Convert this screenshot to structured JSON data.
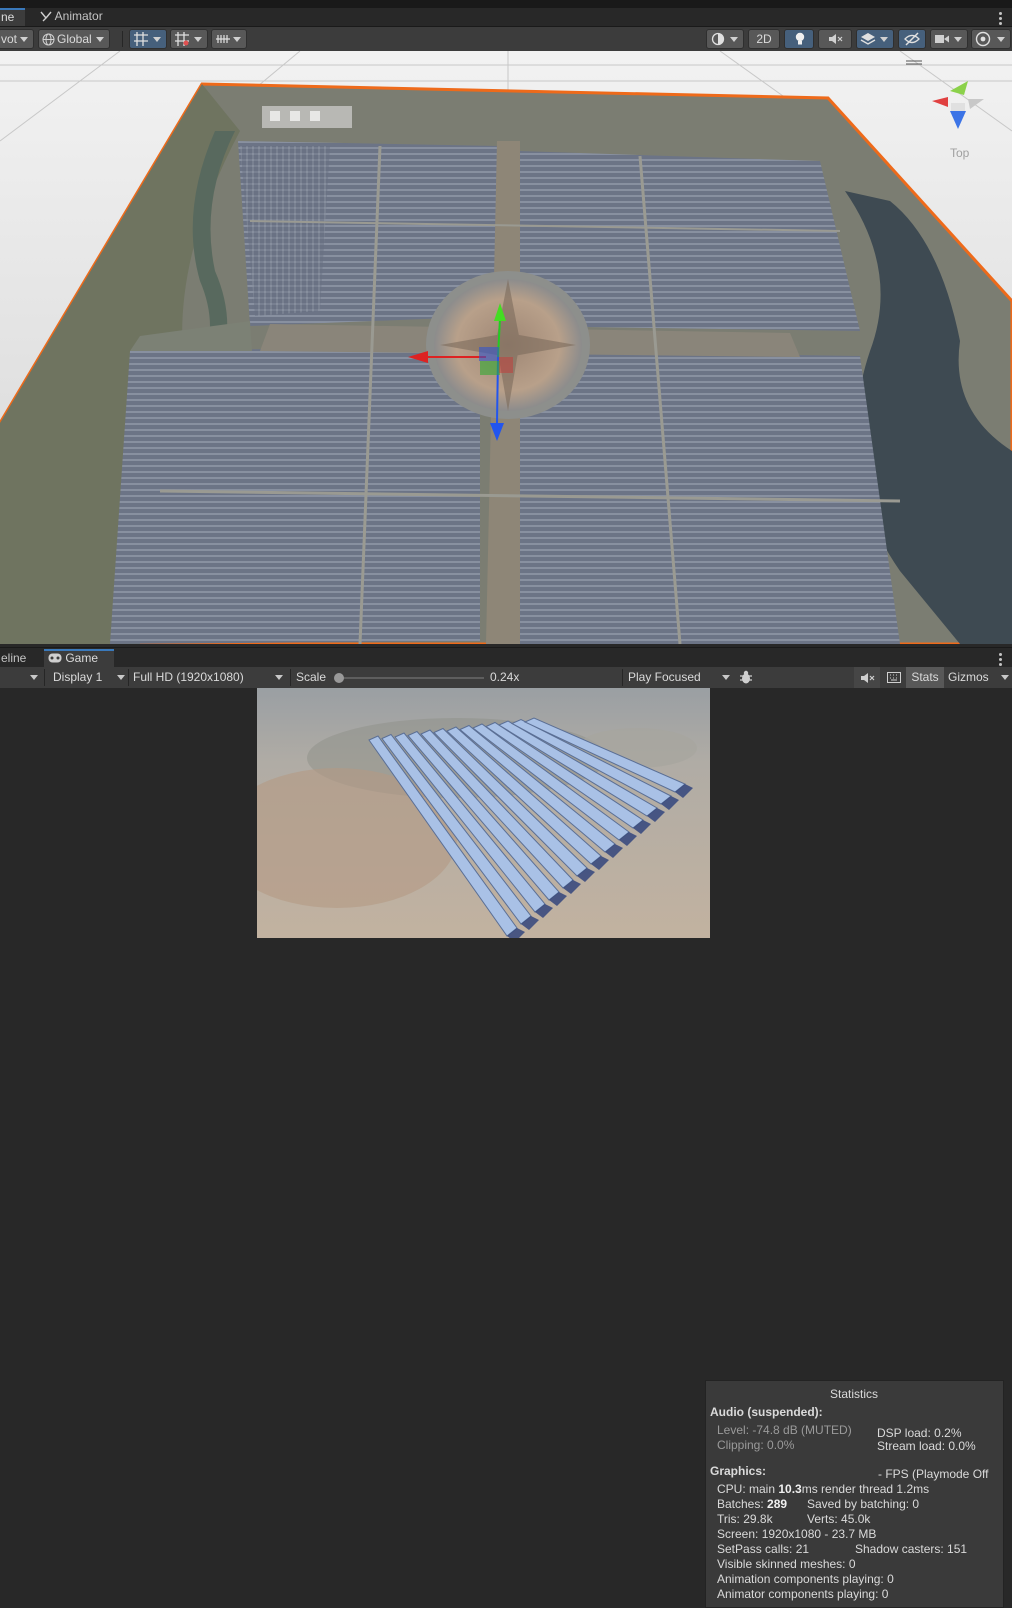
{
  "tabs": {
    "scene_label": "ne",
    "animator_label": "Animator"
  },
  "toolbar": {
    "pivot_label": "vot",
    "global_label": "Global",
    "mode_2d_label": "2D"
  },
  "scene": {
    "orientation_label": "Top"
  },
  "game_tabs": {
    "timeline_label": "eline",
    "game_label": "Game"
  },
  "game_toolbar": {
    "display_label": "Display 1",
    "resolution_label": "Full HD (1920x1080)",
    "scale_label": "Scale",
    "scale_value": "0.24x",
    "scale_slider_fraction": 0.0,
    "play_mode_label": "Play Focused",
    "stats_label": "Stats",
    "gizmos_label": "Gizmos"
  },
  "stats": {
    "title": "Statistics",
    "audio_heading": "Audio (suspended):",
    "level": "Level: -74.8 dB (MUTED)",
    "clipping": "Clipping: 0.0%",
    "dsp_load": "DSP load: 0.2%",
    "stream_load": "Stream load: 0.0%",
    "graphics_heading": "Graphics:",
    "fps": "- FPS (Playmode Off",
    "cpu_prefix": "CPU: main ",
    "cpu_main": "10.3",
    "cpu_suffix": "ms  render thread 1.2ms",
    "batches_prefix": "Batches: ",
    "batches": "289",
    "saved_by_batching": "Saved by batching: 0",
    "tris": "Tris: 29.8k",
    "verts": "Verts: 45.0k",
    "screen": "Screen: 1920x1080 - 23.7 MB",
    "setpass": "SetPass calls: 21",
    "shadow_casters": "Shadow casters: 151",
    "skinned_meshes": "Visible skinned meshes: 0",
    "animation_components": "Animation components playing: 0",
    "animator_components": "Animator components playing: 0"
  }
}
